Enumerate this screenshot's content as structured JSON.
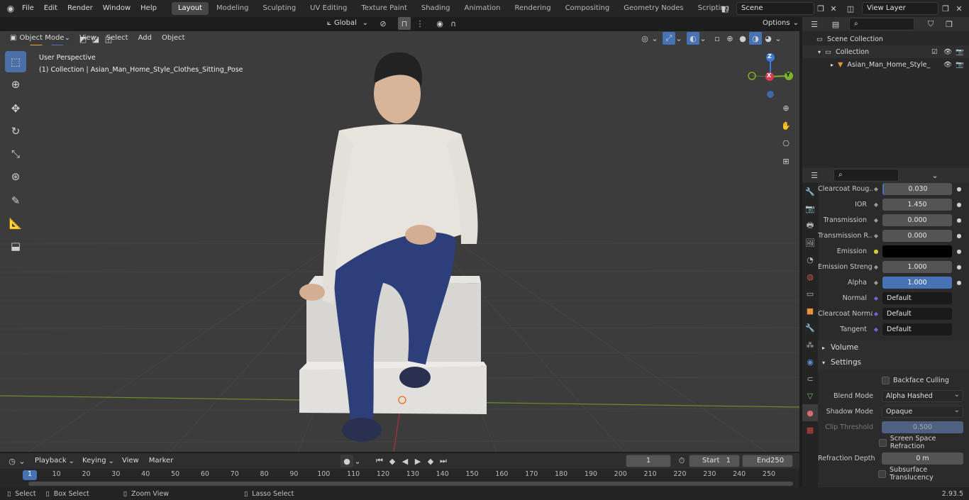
{
  "topbar": {
    "menus": [
      "File",
      "Edit",
      "Render",
      "Window",
      "Help"
    ],
    "workspaces": [
      "Layout",
      "Modeling",
      "Sculpting",
      "UV Editing",
      "Texture Paint",
      "Shading",
      "Animation",
      "Rendering",
      "Compositing",
      "Geometry Nodes",
      "Scripting"
    ],
    "active_workspace": "Layout",
    "scene_name": "Scene",
    "view_layer": "View Layer"
  },
  "viewport_header": {
    "mode": "Object Mode",
    "menus": [
      "View",
      "Select",
      "Add",
      "Object"
    ],
    "transform_orientation": "Global",
    "options_label": "Options"
  },
  "viewport": {
    "perspective_label": "User Perspective",
    "collection_label": "(1) Collection | Asian_Man_Home_Style_Clothes_Sitting_Pose",
    "gizmo_axes": {
      "x": "X",
      "y": "Y",
      "z": "Z"
    }
  },
  "outliner": {
    "scene_collection": "Scene Collection",
    "collection": "Collection",
    "object": "Asian_Man_Home_Style_"
  },
  "properties": {
    "rows": [
      {
        "label": "Clearcoat Roug...",
        "value": "0.030",
        "style": "normal"
      },
      {
        "label": "IOR",
        "value": "1.450",
        "style": "normal"
      },
      {
        "label": "Transmission",
        "value": "0.000",
        "style": "normal"
      },
      {
        "label": "Transmission R...",
        "value": "0.000",
        "style": "normal"
      },
      {
        "label": "Emission",
        "value": "",
        "style": "black"
      },
      {
        "label": "Emission Strengt",
        "value": "1.000",
        "style": "normal"
      },
      {
        "label": "Alpha",
        "value": "1.000",
        "style": "blue"
      },
      {
        "label": "Normal",
        "value": "Default",
        "style": "dark"
      },
      {
        "label": "Clearcoat Normal",
        "value": "Default",
        "style": "dark"
      },
      {
        "label": "Tangent",
        "value": "Default",
        "style": "dark"
      }
    ],
    "volume_panel": "Volume",
    "settings_panel": "Settings",
    "backface_culling": "Backface Culling",
    "blend_mode_label": "Blend Mode",
    "blend_mode_value": "Alpha Hashed",
    "shadow_mode_label": "Shadow Mode",
    "shadow_mode_value": "Opaque",
    "clip_threshold_label": "Clip Threshold",
    "clip_threshold_value": "0.500",
    "screen_space_refraction": "Screen Space Refraction",
    "refraction_depth_label": "Refraction Depth",
    "refraction_depth_value": "0 m",
    "subsurface_translucency": "Subsurface Translucency"
  },
  "timeline": {
    "menus": [
      "Playback",
      "Keying",
      "View",
      "Marker"
    ],
    "current_frame": "1",
    "start_label": "Start",
    "start_value": "1",
    "end_label": "End",
    "end_value": "250",
    "ticks": [
      "1",
      "10",
      "20",
      "30",
      "40",
      "50",
      "60",
      "70",
      "80",
      "90",
      "100",
      "110",
      "120",
      "130",
      "140",
      "150",
      "160",
      "170",
      "180",
      "190",
      "200",
      "210",
      "220",
      "230",
      "240",
      "250"
    ]
  },
  "statusbar": {
    "select": "Select",
    "box_select": "Box Select",
    "zoom_view": "Zoom View",
    "lasso_select": "Lasso Select",
    "version": "2.93.5"
  },
  "colors": {
    "accent": "#4772b3",
    "viewport_bg": "#3c3c3c",
    "x_axis": "#e0384f",
    "y_axis": "#7cb32b",
    "z_axis": "#3d7ad8"
  }
}
